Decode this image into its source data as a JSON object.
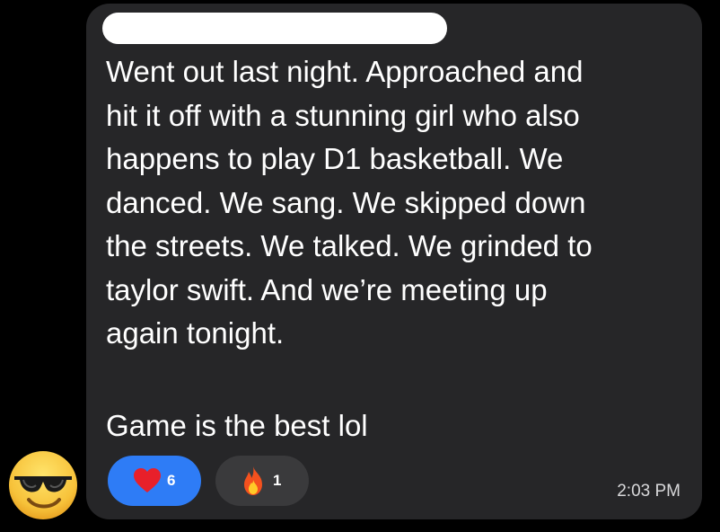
{
  "message": {
    "sender_name_redacted": "",
    "body": "Went out last night. Approached and\nhit it off with a stunning girl who also\nhappens to play D1 basketball. We\ndanced. We sang. We skipped down\nthe streets. We talked. We grinded to\ntaylor swift. And we’re meeting up\nagain tonight.",
    "signoff": "Game is the best lol",
    "timestamp": "2:03 PM"
  },
  "reactions": [
    {
      "icon": "heart-icon",
      "count": "6",
      "color": "#2e7cf6"
    },
    {
      "icon": "fire-icon",
      "count": "1",
      "color": "#3a3a3c"
    }
  ],
  "avatar": {
    "icon": "sunglasses-face-emoji"
  },
  "colors": {
    "background": "#000000",
    "bubble": "#262628",
    "text": "#ffffff",
    "accent": "#2e7cf6"
  }
}
